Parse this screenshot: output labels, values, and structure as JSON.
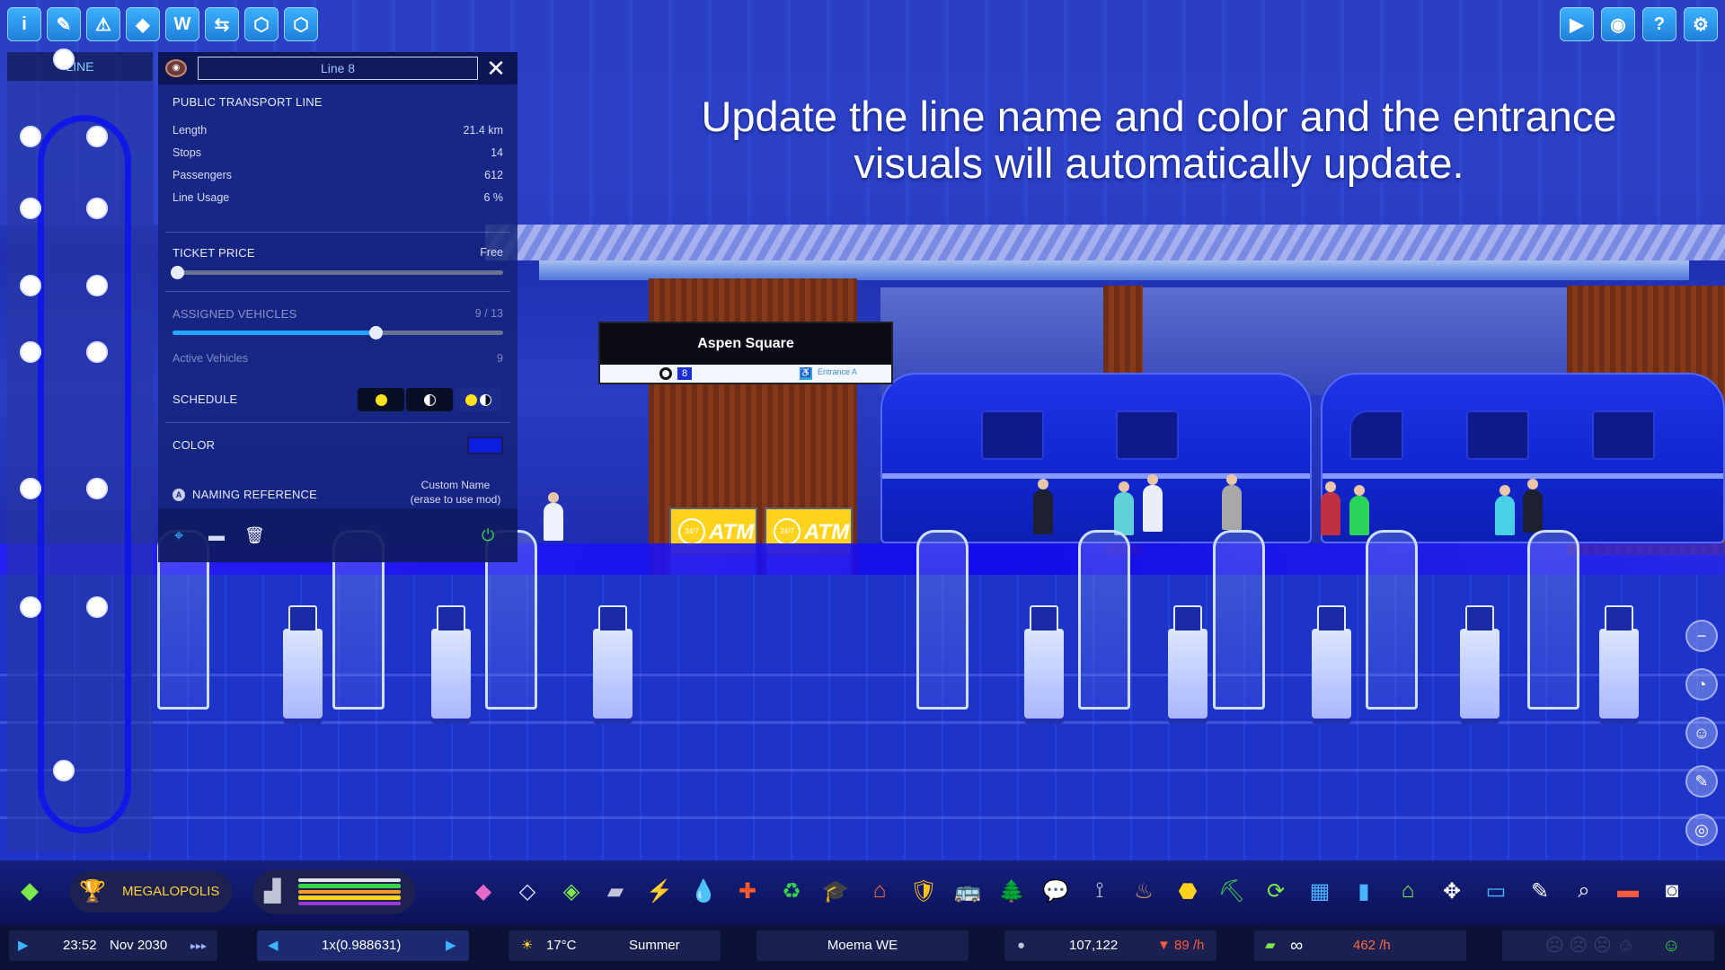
{
  "top_toolbar": {
    "left_icons": [
      "info-icon",
      "policies-icon",
      "road-services-icon",
      "zoning-icon",
      "budget-icon",
      "logistics-icon",
      "transport-icon-a",
      "transport-icon-b"
    ],
    "left_glyphs": [
      "i",
      "✎",
      "⚠",
      "◆",
      "W",
      "⇆",
      "⬡",
      "⬡"
    ],
    "right_icons": [
      "camera-icon",
      "achievement-icon",
      "help-icon",
      "settings-icon"
    ],
    "right_glyphs": [
      "▶",
      "◉",
      "?",
      "⚙"
    ]
  },
  "headline": {
    "line1": "Update the line name and color and the entrance",
    "line2": "visuals will automatically update."
  },
  "line_panel": {
    "header": "LINE",
    "stops_count": 14
  },
  "info_panel": {
    "name_value": "Line 8",
    "close_glyph": "✕",
    "section_title": "PUBLIC TRANSPORT LINE",
    "stats": [
      {
        "label": "Length",
        "value": "21.4 km"
      },
      {
        "label": "Stops",
        "value": "14"
      },
      {
        "label": "Passengers",
        "value": "612"
      },
      {
        "label": "Line Usage",
        "value": "6 %"
      }
    ],
    "ticket_price": {
      "label": "TICKET PRICE",
      "value": "Free",
      "level": 0
    },
    "assigned_vehicles": {
      "label": "ASSIGNED VEHICLES",
      "value": "9 / 13",
      "level": 0.6
    },
    "active_vehicles": {
      "label": "Active Vehicles",
      "value": "9"
    },
    "schedule": {
      "label": "SCHEDULE",
      "options": [
        "day",
        "night",
        "day-and-night"
      ],
      "selected": "day-and-night"
    },
    "color": {
      "label": "COLOR",
      "value": "#0b1fe0"
    },
    "naming_reference": {
      "label": "NAMING REFERENCE",
      "badge": "A",
      "hint_line1": "Custom Name",
      "hint_line2": "(erase to use mod)"
    },
    "actions": [
      "location-pin-icon",
      "vehicle-icon",
      "trash-icon",
      "power-icon"
    ]
  },
  "station_sign": {
    "name": "Aspen Square",
    "line_number": "8",
    "entrance": "Entrance A"
  },
  "atm": {
    "label": "ATM",
    "badge": "24/7"
  },
  "bottom_toolbar": {
    "milestone": "MEGALOPOLIS",
    "progress_colors": [
      "#e6e6e6",
      "#3ad24a",
      "#ff9a2a",
      "#ffd21c",
      "#9a3ad2"
    ],
    "tools": [
      "roads-icon",
      "zoning-icon",
      "area-icon",
      "landscaping-icon",
      "electricity-icon",
      "water-icon",
      "health-icon",
      "garbage-icon",
      "education-icon",
      "fire-icon",
      "police-icon",
      "transport-icon",
      "parks-icon",
      "communications-icon",
      "landscape-tools-icon",
      "wastewater-icon",
      "districts-icon",
      "bulldozer-icon",
      "upgrade-icon",
      "budget-icon",
      "statistics-icon",
      "city-services-icon",
      "move-it-icon",
      "photo-icon",
      "eyedropper-icon",
      "search-icon",
      "eraser-icon",
      "screenshot-icon"
    ],
    "tool_glyphs": [
      "◆",
      "◇",
      "◈",
      "▰",
      "⚡",
      "💧",
      "✚",
      "♻",
      "🎓",
      "⌂",
      "🛡",
      "🚌",
      "🌲",
      "💬",
      "⟟",
      "♨",
      "⬣",
      "⛏",
      "⟳",
      "▦",
      "▮",
      "⌂",
      "✥",
      "▭",
      "✎",
      "⌕",
      "▬",
      "◙"
    ],
    "tool_colors": [
      "#e868c8",
      "#dfe8ff",
      "#7ee84a",
      "#c0c4d6",
      "#ffd21c",
      "#4ab4ff",
      "#ff5a2a",
      "#3ad24a",
      "#c0c4d6",
      "#ff6a2a",
      "#ffc21c",
      "#3ad24a",
      "#3ad24a",
      "#ffffff",
      "#c0c4d6",
      "#d0a060",
      "#ffd21c",
      "#3ad24a",
      "#7ee84a",
      "#4ab4ff",
      "#4ab4ff",
      "#7ee84a",
      "#ffffff",
      "#4ab4ff",
      "#ffffff",
      "#ffffff",
      "#ff5a3a",
      "#ffffff"
    ]
  },
  "status_bar": {
    "time": "23:52",
    "date": "Nov 2030",
    "speed_glyph": "▸▸▸",
    "simulation_speed": "1x(0.988631)",
    "temperature": "17°C",
    "season": "Summer",
    "city_name": "Moema WE",
    "population": "107,122",
    "population_rate": "89 /h",
    "money": "∞",
    "money_rate": "462 /h"
  },
  "right_tools": [
    "zoom-out-icon",
    "compass-icon",
    "citizen-icon",
    "notes-icon",
    "radar-icon"
  ],
  "right_tool_glyphs": [
    "−",
    "◔",
    "☺",
    "✎",
    "◎"
  ]
}
